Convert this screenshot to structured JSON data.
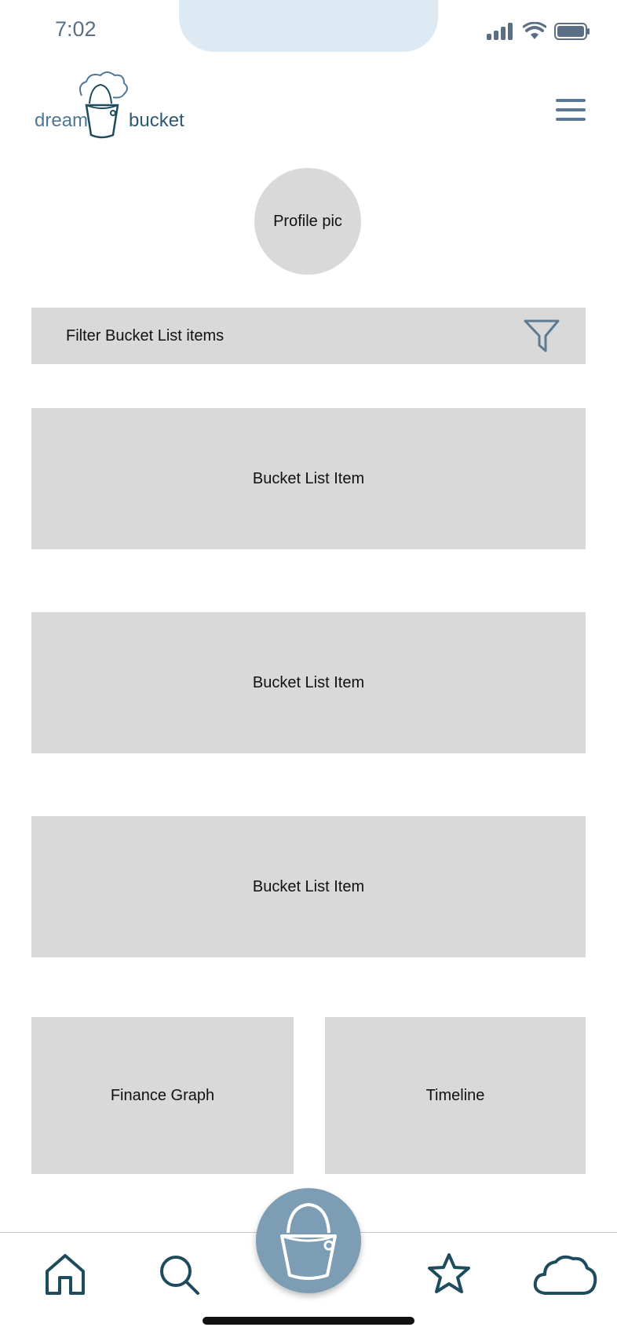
{
  "status_bar": {
    "time": "7:02"
  },
  "logo": {
    "word_left": "dream",
    "word_right": "bucket"
  },
  "profile": {
    "label": "Profile pic"
  },
  "filter": {
    "label": "Filter Bucket List items"
  },
  "bucket_items": [
    {
      "label": "Bucket List Item"
    },
    {
      "label": "Bucket List Item"
    },
    {
      "label": "Bucket List Item"
    }
  ],
  "widgets": {
    "finance": "Finance Graph",
    "timeline": "Timeline"
  },
  "colors": {
    "accent": "#7d9db5",
    "icon_dark": "#1f4b5e",
    "placeholder": "#d9d9d9"
  },
  "nav": {
    "icons": [
      "home-icon",
      "search-icon",
      "bucket-icon",
      "star-icon",
      "cloud-icon"
    ]
  }
}
